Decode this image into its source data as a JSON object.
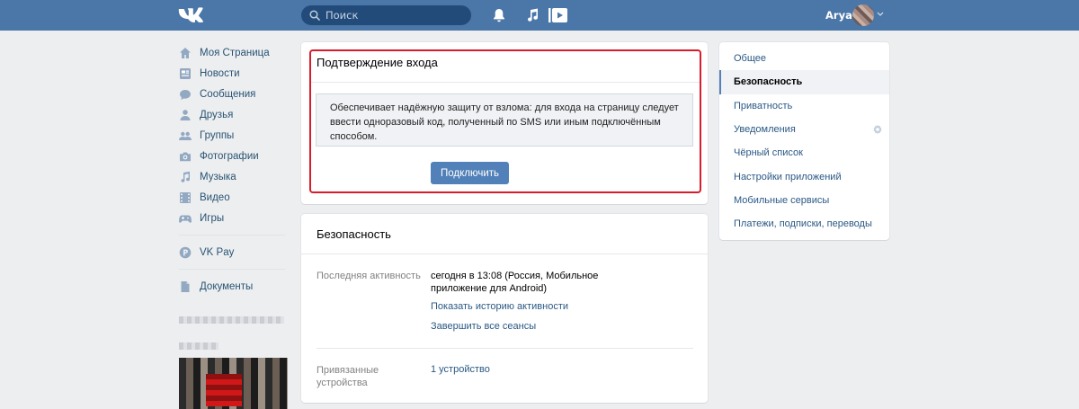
{
  "header": {
    "logo": "vk-logo",
    "search_placeholder": "Поиск",
    "user_name": "Arya"
  },
  "leftnav": {
    "items": [
      {
        "label": "Моя Страница",
        "icon": "home-icon"
      },
      {
        "label": "Новости",
        "icon": "news-icon"
      },
      {
        "label": "Сообщения",
        "icon": "messages-icon"
      },
      {
        "label": "Друзья",
        "icon": "friends-icon"
      },
      {
        "label": "Группы",
        "icon": "groups-icon"
      },
      {
        "label": "Фотографии",
        "icon": "camera-icon"
      },
      {
        "label": "Музыка",
        "icon": "music-icon"
      },
      {
        "label": "Видео",
        "icon": "video-icon"
      },
      {
        "label": "Игры",
        "icon": "gamepad-icon"
      }
    ],
    "vkpay": "VK Pay",
    "documents": "Документы"
  },
  "login_confirm": {
    "title": "Подтверждение входа",
    "description": "Обеспечивает надёжную защиту от взлома: для входа на страницу следует ввести одноразовый код, полученный по SMS или иным подключённым способом.",
    "button": "Подключить",
    "highlight_color": "#d81c2a"
  },
  "security": {
    "title": "Безопасность",
    "last_activity_label": "Последняя активность",
    "last_activity_value": "сегодня в 13:08 (Россия, Мобильное приложение для Android)",
    "show_history_link": "Показать историю активности",
    "end_sessions_link": "Завершить все сеансы",
    "linked_devices_label": "Привязанные устройства",
    "linked_devices_value": "1 устройство"
  },
  "settings_menu": {
    "items": [
      {
        "label": "Общее",
        "active": false
      },
      {
        "label": "Безопасность",
        "active": true
      },
      {
        "label": "Приватность",
        "active": false
      },
      {
        "label": "Уведомления",
        "active": false
      },
      {
        "label": "Чёрный список",
        "active": false
      },
      {
        "label": "Настройки приложений",
        "active": false
      },
      {
        "label": "Мобильные сервисы",
        "active": false
      },
      {
        "label": "Платежи, подписки, переводы",
        "active": false
      }
    ]
  },
  "colors": {
    "header": "#4a76a8",
    "accent": "#5181b8",
    "link": "#2a5885",
    "background": "#edeef0"
  }
}
